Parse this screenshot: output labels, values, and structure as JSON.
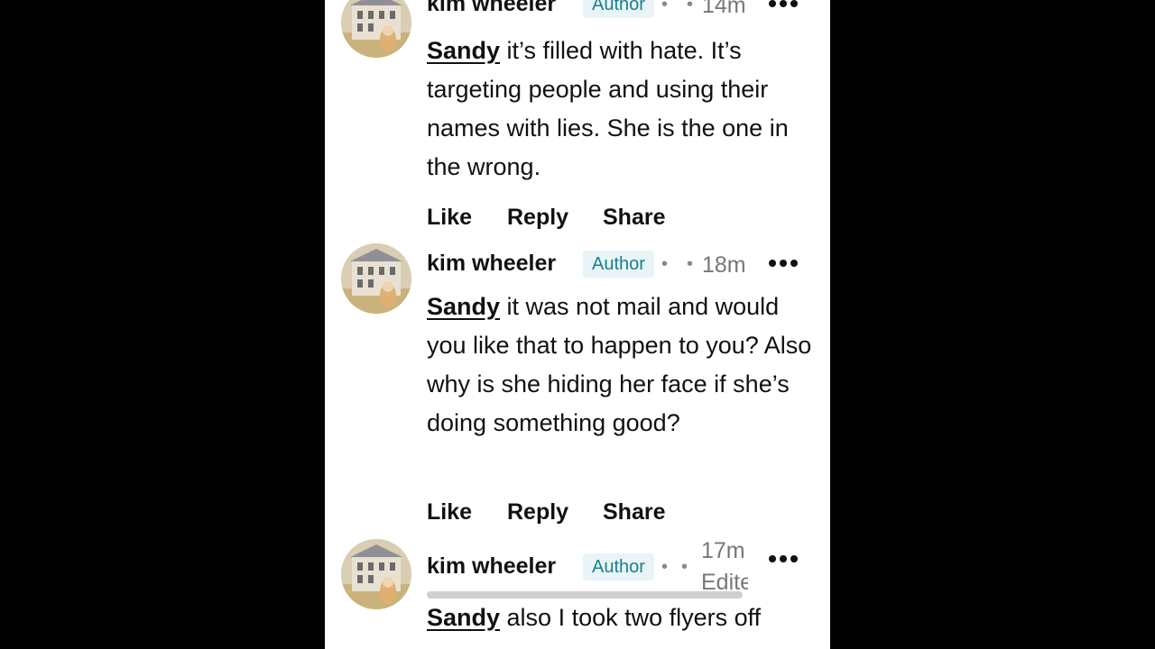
{
  "comments": [
    {
      "author": "kim wheeler",
      "badge": "Author",
      "time": "14m",
      "mention": "Sandy",
      "text": " it’s filled with hate. It’s targeting people and using their names with lies. She is the one in the wrong."
    },
    {
      "author": "kim wheeler",
      "badge": "Author",
      "time": "18m",
      "mention": "Sandy",
      "text": " it was not mail and would you like that to happen to you? Also why is she hiding her face if she’s doing something good?"
    },
    {
      "author": "kim wheeler",
      "badge": "Author",
      "time": "17m",
      "edited": "Edited",
      "mention": "Sandy",
      "text": " also I took two flyers off"
    }
  ],
  "actions": {
    "like": "Like",
    "reply": "Reply",
    "share": "Share"
  },
  "icons": {
    "more": "more-options-icon",
    "separator": "dot-separator-icon"
  },
  "colors": {
    "badge_text": "#1a7f8c",
    "badge_bg": "#e8f4f6",
    "time": "#777777"
  }
}
